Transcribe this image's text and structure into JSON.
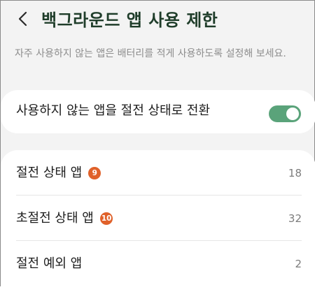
{
  "header": {
    "title": "백그라운드 앱 사용 제한",
    "back_icon": "chevron-left-icon"
  },
  "description": "자주 사용하지 않는 앱은 배터리를 적게 사용하도록 설정해 보세요.",
  "toggle": {
    "label": "사용하지 않는 앱을 절전 상태로 전환",
    "state": "on",
    "color": "#5aa37a"
  },
  "list": {
    "items": [
      {
        "label": "절전 상태 앱",
        "badge": "9",
        "count": "18"
      },
      {
        "label": "초절전 상태 앱",
        "badge": "10",
        "count": "32"
      },
      {
        "label": "절전 예외 앱",
        "count": "2"
      }
    ],
    "badge_color": "#e0612a"
  }
}
